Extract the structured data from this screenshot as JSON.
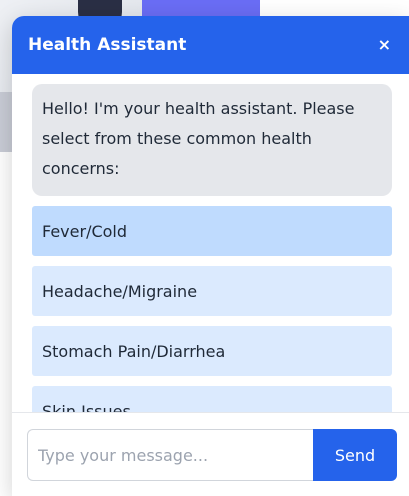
{
  "widget": {
    "title": "Health Assistant",
    "close_icon": "×"
  },
  "messages": {
    "greeting": "Hello! I'm your health assistant. Please select from these common health concerns:",
    "options": [
      {
        "label": "Fever/Cold",
        "hovered": true
      },
      {
        "label": "Headache/Migraine",
        "hovered": false
      },
      {
        "label": "Stomach Pain/Diarrhea",
        "hovered": false
      },
      {
        "label": "Skin Issues",
        "hovered": false
      }
    ]
  },
  "composer": {
    "placeholder": "Type your message...",
    "value": "",
    "send_label": "Send"
  },
  "colors": {
    "accent": "#2563eb",
    "option_bg": "#dbeafe",
    "option_hover_bg": "#bfdbfe",
    "bot_bubble_bg": "#e5e7eb"
  }
}
